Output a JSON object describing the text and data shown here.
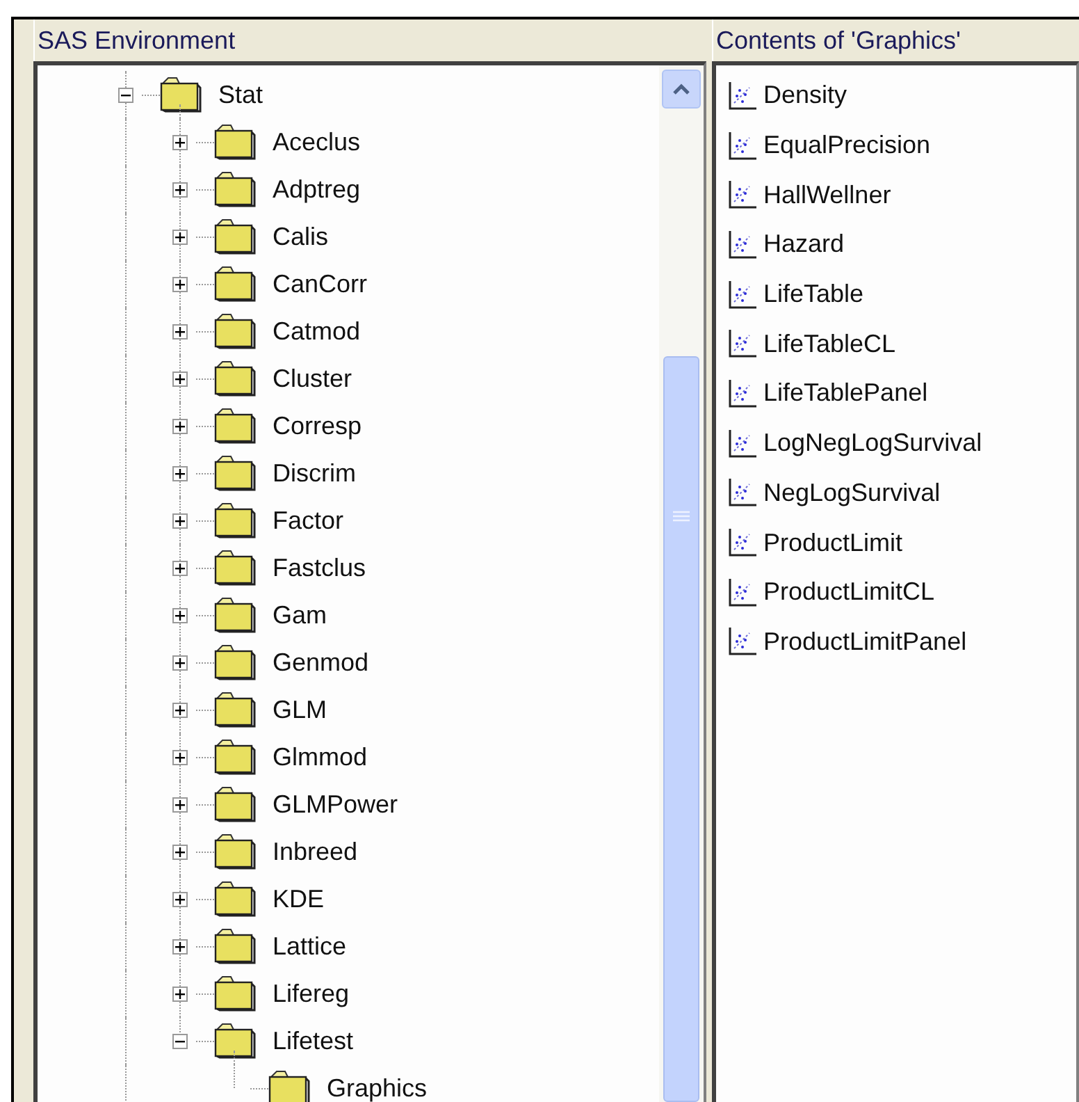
{
  "left_panel": {
    "title": "SAS Environment",
    "tree": [
      {
        "label": "Stat",
        "expanded": true,
        "children": [
          {
            "label": "Aceclus",
            "expanded": false
          },
          {
            "label": "Adptreg",
            "expanded": false
          },
          {
            "label": "Calis",
            "expanded": false
          },
          {
            "label": "CanCorr",
            "expanded": false
          },
          {
            "label": "Catmod",
            "expanded": false
          },
          {
            "label": "Cluster",
            "expanded": false
          },
          {
            "label": "Corresp",
            "expanded": false
          },
          {
            "label": "Discrim",
            "expanded": false
          },
          {
            "label": "Factor",
            "expanded": false
          },
          {
            "label": "Fastclus",
            "expanded": false
          },
          {
            "label": "Gam",
            "expanded": false
          },
          {
            "label": "Genmod",
            "expanded": false
          },
          {
            "label": "GLM",
            "expanded": false
          },
          {
            "label": "Glmmod",
            "expanded": false
          },
          {
            "label": "GLMPower",
            "expanded": false
          },
          {
            "label": "Inbreed",
            "expanded": false
          },
          {
            "label": "KDE",
            "expanded": false
          },
          {
            "label": "Lattice",
            "expanded": false
          },
          {
            "label": "Lifereg",
            "expanded": false
          },
          {
            "label": "Lifetest",
            "expanded": true,
            "children": [
              {
                "label": "Graphics"
              }
            ]
          }
        ]
      }
    ]
  },
  "right_panel": {
    "title": "Contents of 'Graphics'",
    "items": [
      "Density",
      "EqualPrecision",
      "HallWellner",
      "Hazard",
      "LifeTable",
      "LifeTableCL",
      "LifeTablePanel",
      "LogNegLogSurvival",
      "NegLogSurvival",
      "ProductLimit",
      "ProductLimitCL",
      "ProductLimitPanel"
    ]
  }
}
